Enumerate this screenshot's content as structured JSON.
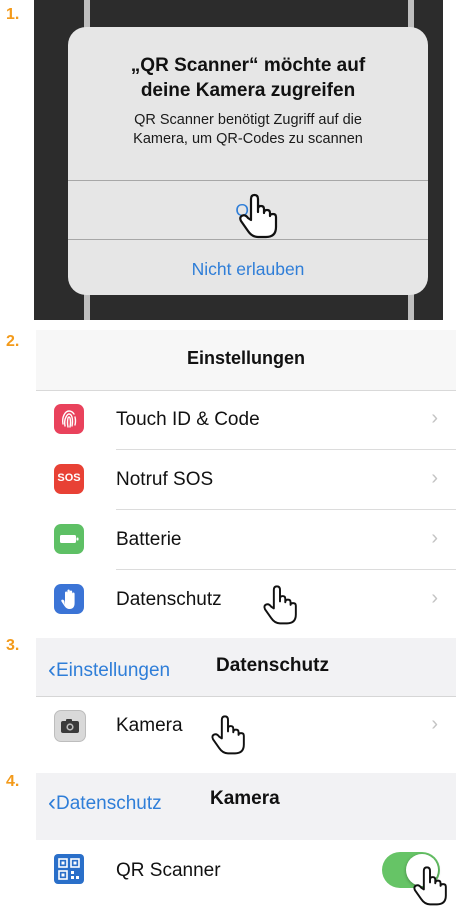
{
  "steps": [
    "1.",
    "2.",
    "3.",
    "4."
  ],
  "dialog": {
    "title_line1": "„QR Scanner“ möchte auf",
    "title_line2": "deine Kamera zugreifen",
    "message_line1": "QR Scanner benötigt Zugriff auf die",
    "message_line2": "Kamera, um QR-Codes zu scannen",
    "ok_label": "OK",
    "deny_label": "Nicht erlauben"
  },
  "settings": {
    "title": "Einstellungen",
    "items": [
      {
        "label": "Touch ID & Code",
        "icon": "fingerprint-icon",
        "color": "#e9425c"
      },
      {
        "label": "Notruf SOS",
        "icon": "sos-icon",
        "color": "#e84135",
        "badge": "SOS"
      },
      {
        "label": "Batterie",
        "icon": "battery-icon",
        "color": "#5ec065"
      },
      {
        "label": "Datenschutz",
        "icon": "hand-icon",
        "color": "#3b74d6"
      }
    ]
  },
  "privacy": {
    "back_label": "Einstellungen",
    "title": "Datenschutz",
    "item_label": "Kamera",
    "item_icon": "camera-icon"
  },
  "camera": {
    "back_label": "Datenschutz",
    "title": "Kamera",
    "app_label": "QR Scanner",
    "app_icon": "qr-code-icon",
    "toggle_on": true
  },
  "colors": {
    "step_number": "#f39a1a",
    "ios_blue": "#2f7ed8",
    "toggle_green": "#66c466"
  }
}
